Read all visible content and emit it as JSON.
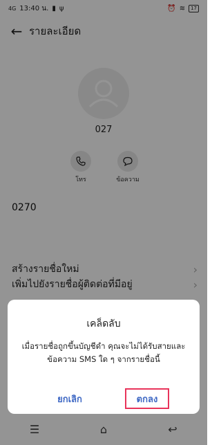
{
  "statusbar": {
    "time": "13:40 น.",
    "signal": "4G",
    "battery": "17"
  },
  "header": {
    "title": "รายละเอียด"
  },
  "contact": {
    "name": "027",
    "phone": "0270"
  },
  "actions": [
    {
      "label": "โทร",
      "icon": "phone-icon"
    },
    {
      "label": "ข้อความ",
      "icon": "message-icon"
    }
  ],
  "list": [
    {
      "label": "สร้างรายชื่อใหม่"
    },
    {
      "label": "เพิ่มไปยังรายชื่อผู้ติดต่อที่มีอยู่"
    }
  ],
  "dialog": {
    "title": "เคล็ดลับ",
    "message": "เมื่อรายชื่อถูกขึ้นบัญชีดำ คุณจะไม่ได้รับสายและข้อความ SMS ใด ๆ จากรายชื่อนี้",
    "cancel_label": "ยกเลิก",
    "ok_label": "ตกลง"
  },
  "colors": {
    "accent": "#3e68c4",
    "highlight": "#e8335a"
  }
}
